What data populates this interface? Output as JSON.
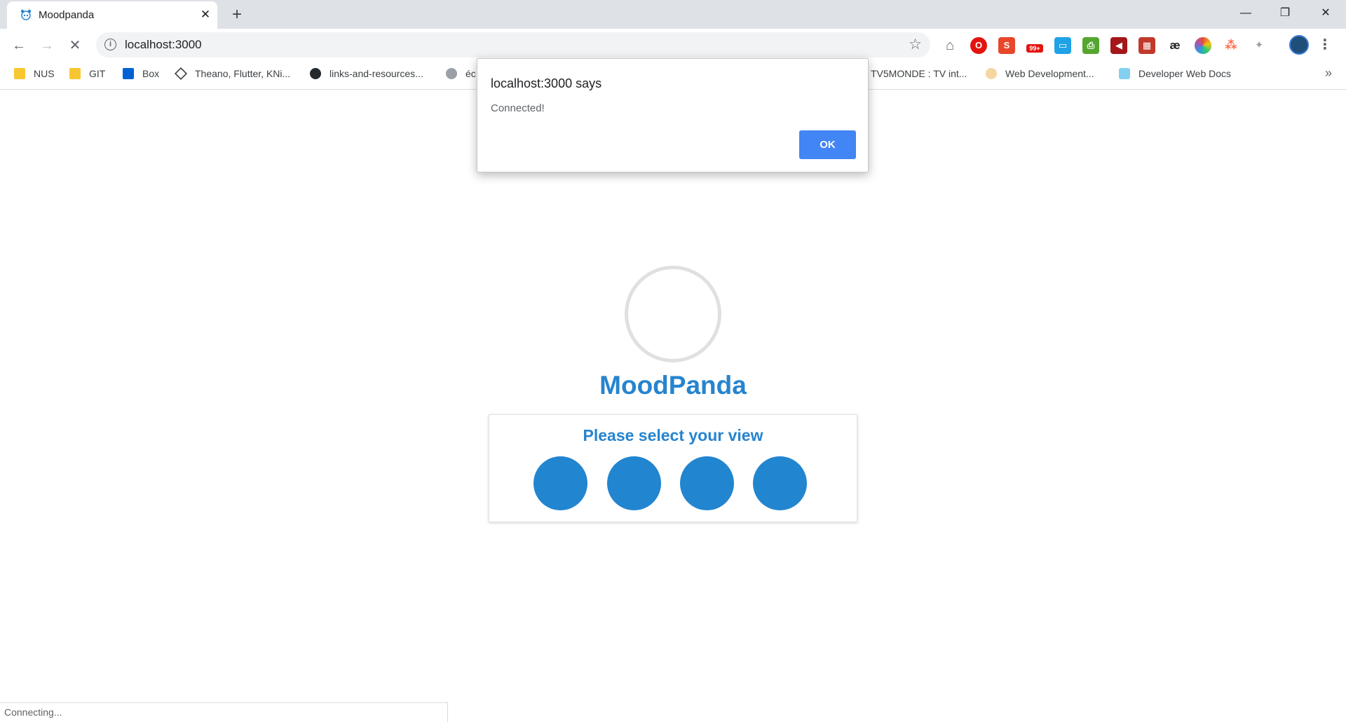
{
  "browser": {
    "tab_title": "Moodpanda",
    "url": "localhost:3000",
    "bookmarks": [
      {
        "label": "NUS",
        "icon": "folder-icon"
      },
      {
        "label": "GIT",
        "icon": "folder-icon"
      },
      {
        "label": "Box",
        "icon": "box-icon"
      },
      {
        "label": "Theano, Flutter, KNi...",
        "icon": "diamond-icon"
      },
      {
        "label": "links-and-resources...",
        "icon": "github-icon"
      },
      {
        "label": "éc",
        "icon": "globe-icon"
      },
      {
        "label": "TV5MONDE : TV int...",
        "icon": "page-icon"
      },
      {
        "label": "Web Development...",
        "icon": "owl-icon"
      },
      {
        "label": "Developer Web Docs",
        "icon": "docs-icon"
      }
    ],
    "status_text": "Connecting...",
    "extension_badge": "99+"
  },
  "app": {
    "title": "MoodPanda",
    "view_prompt": "Please select your view",
    "view_buttons": [
      "view-1",
      "view-2",
      "view-3",
      "view-4"
    ]
  },
  "dialog": {
    "title": "localhost:3000 says",
    "message": "Connected!",
    "ok_label": "OK"
  },
  "colors": {
    "accent": "#2684cf",
    "view_button": "#2285d0",
    "dialog_button": "#4285f4"
  }
}
